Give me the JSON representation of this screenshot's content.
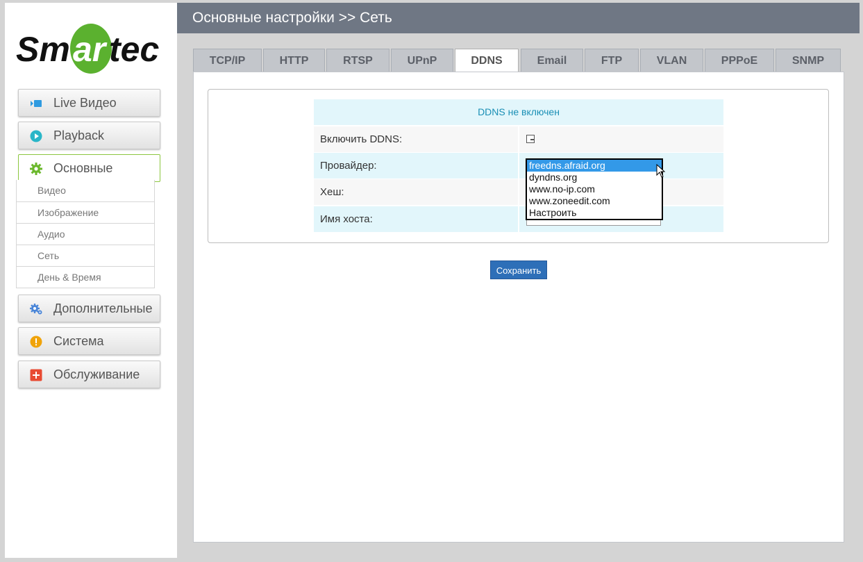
{
  "brand": {
    "logo_text": "Smartec",
    "colors": {
      "green": "#5bb12f",
      "black": "#111111"
    }
  },
  "header": {
    "title": "Основные настройки >> Сеть"
  },
  "sidebar": {
    "items": [
      {
        "label": "Live Видео",
        "icon": "live-video-icon",
        "color": "#2f9be0"
      },
      {
        "label": "Playback",
        "icon": "play-icon",
        "color": "#29b6c8"
      },
      {
        "label": "Основные",
        "icon": "gear-icon",
        "color": "#6bb82c",
        "active": true
      },
      {
        "label": "Дополнительные",
        "icon": "gears-icon",
        "color": "#4a86d8"
      },
      {
        "label": "Система",
        "icon": "warning-icon",
        "color": "#f0a30a"
      },
      {
        "label": "Обслуживание",
        "icon": "plus-icon",
        "color": "#e84a32"
      }
    ],
    "submenu": [
      "Видео",
      "Изображение",
      "Аудио",
      "Сеть",
      "День & Время"
    ]
  },
  "tabs": [
    "TCP/IP",
    "HTTP",
    "RTSP",
    "UPnP",
    "DDNS",
    "Email",
    "FTP",
    "VLAN",
    "PPPoE",
    "SNMP"
  ],
  "active_tab": "DDNS",
  "form": {
    "status": "DDNS не включен",
    "enable_label": "Включить DDNS:",
    "provider_label": "Провайдер:",
    "hash_label": "Хеш:",
    "hostname_label": "Имя хоста:",
    "provider_options": [
      "freedns.afraid.org",
      "dyndns.org",
      "www.no-ip.com",
      "www.zoneedit.com",
      "Настроить"
    ],
    "provider_selected": "freedns.afraid.org"
  },
  "save_label": "Сохранить"
}
